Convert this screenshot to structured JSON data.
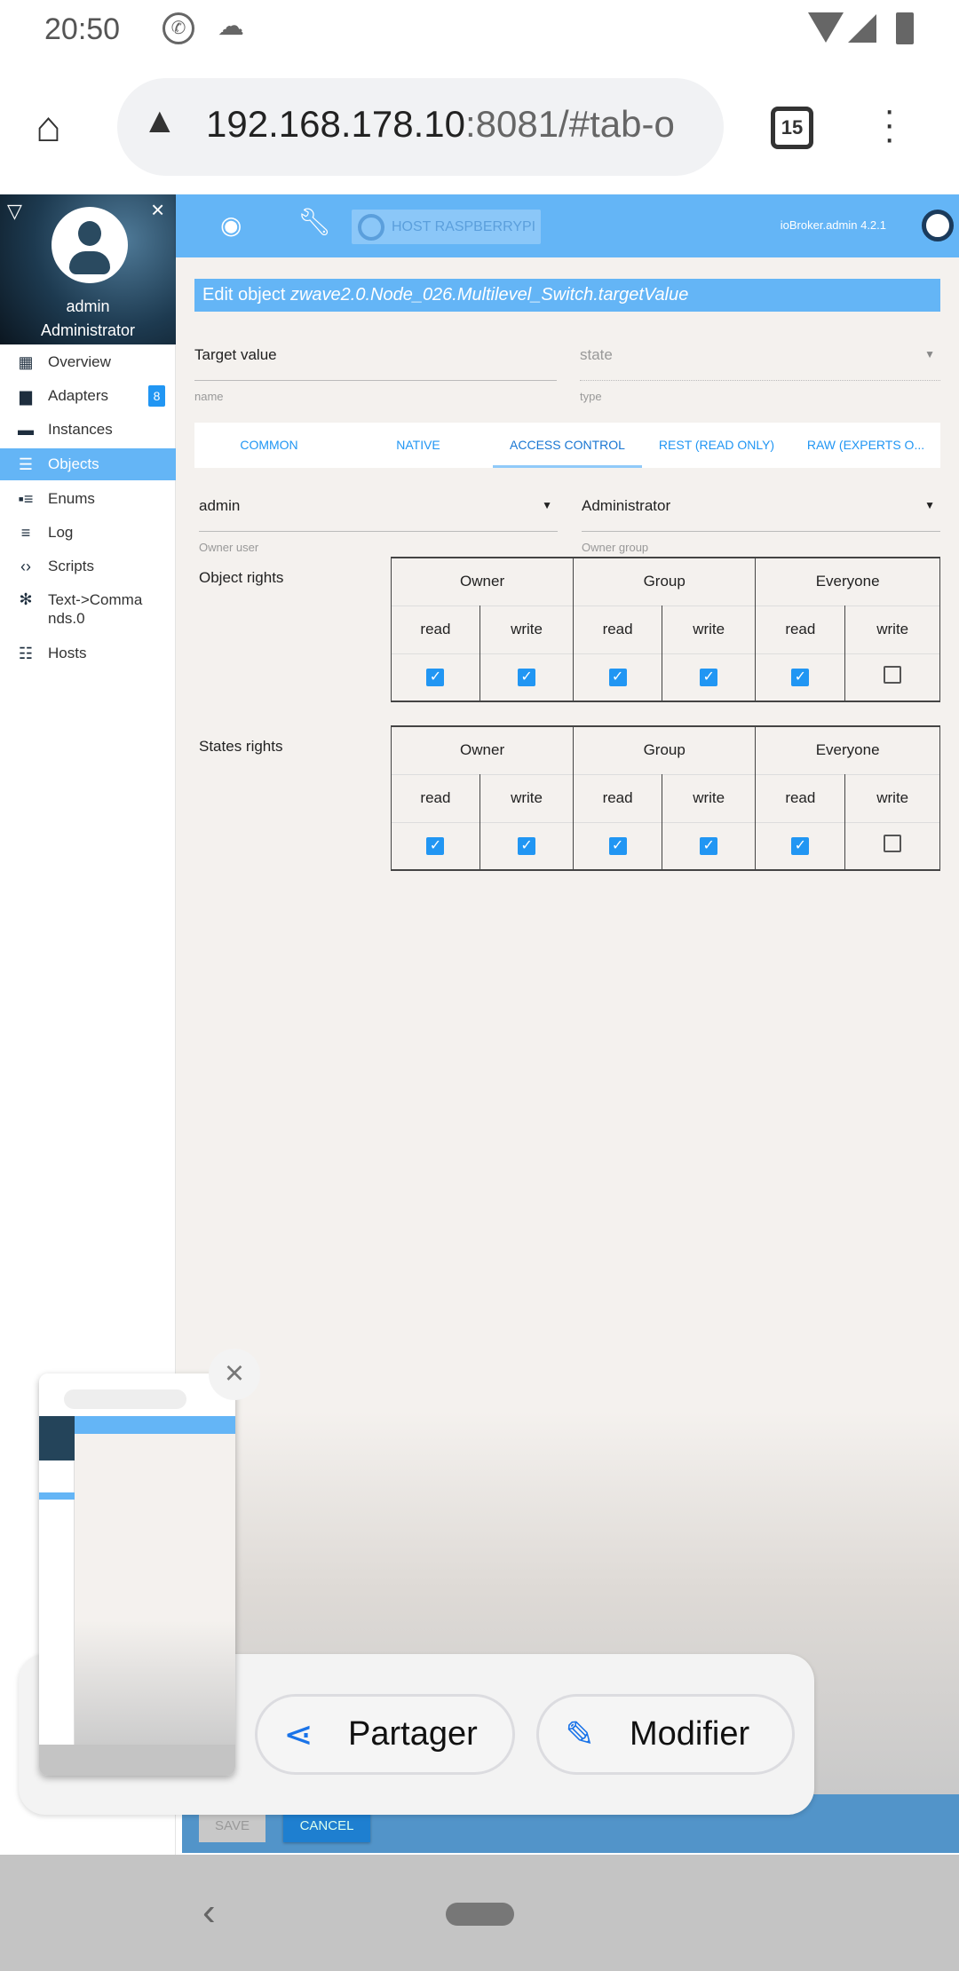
{
  "status_bar": {
    "time": "20:50"
  },
  "browser": {
    "url_host": "192.168.178.10",
    "url_rest": ":8081/#tab-o",
    "tab_count": "15"
  },
  "sidebar": {
    "user": "admin",
    "role": "Administrator",
    "items": [
      {
        "label": "Overview",
        "icon": "grid-icon"
      },
      {
        "label": "Adapters",
        "icon": "store-icon",
        "badge": "8"
      },
      {
        "label": "Instances",
        "icon": "instances-icon"
      },
      {
        "label": "Objects",
        "icon": "list-icon",
        "selected": true
      },
      {
        "label": "Enums",
        "icon": "enums-icon"
      },
      {
        "label": "Log",
        "icon": "log-icon"
      },
      {
        "label": "Scripts",
        "icon": "code-icon"
      },
      {
        "label": "Text->Commands.0",
        "icon": "snowflake-icon"
      },
      {
        "label": "Hosts",
        "icon": "hosts-icon"
      }
    ]
  },
  "appbar": {
    "host_label": "HOST RASPBERRYPI",
    "version": "ioBroker.admin 4.2.1"
  },
  "dialog": {
    "title_prefix": "Edit object ",
    "title_id": "zwave2.0.Node_026.Multilevel_Switch.targetValue",
    "name_value": "Target value",
    "name_label": "name",
    "type_value": "state",
    "type_label": "type",
    "tabs": [
      "Common",
      "Native",
      "Access control",
      "Rest (read only)",
      "Raw (experts o..."
    ],
    "active_tab": "Access control",
    "owner_user": "admin",
    "owner_user_label": "Owner user",
    "owner_group": "Administrator",
    "owner_group_label": "Owner group",
    "sections": [
      {
        "label": "Object rights",
        "groups": [
          "Owner",
          "Group",
          "Everyone"
        ],
        "cols": [
          "read",
          "write",
          "read",
          "write",
          "read",
          "write"
        ],
        "checked": [
          true,
          true,
          true,
          true,
          true,
          false
        ]
      },
      {
        "label": "States rights",
        "groups": [
          "Owner",
          "Group",
          "Everyone"
        ],
        "cols": [
          "read",
          "write",
          "read",
          "write",
          "read",
          "write"
        ],
        "checked": [
          true,
          true,
          true,
          true,
          true,
          false
        ]
      }
    ],
    "save_label": "SAVE",
    "cancel_label": "CANCEL"
  },
  "share_sheet": {
    "share_label": "Partager",
    "edit_label": "Modifier"
  },
  "colors": {
    "accent": "#64b5f6",
    "checkbox": "#2196f3",
    "tab_text": "#2196f3"
  }
}
